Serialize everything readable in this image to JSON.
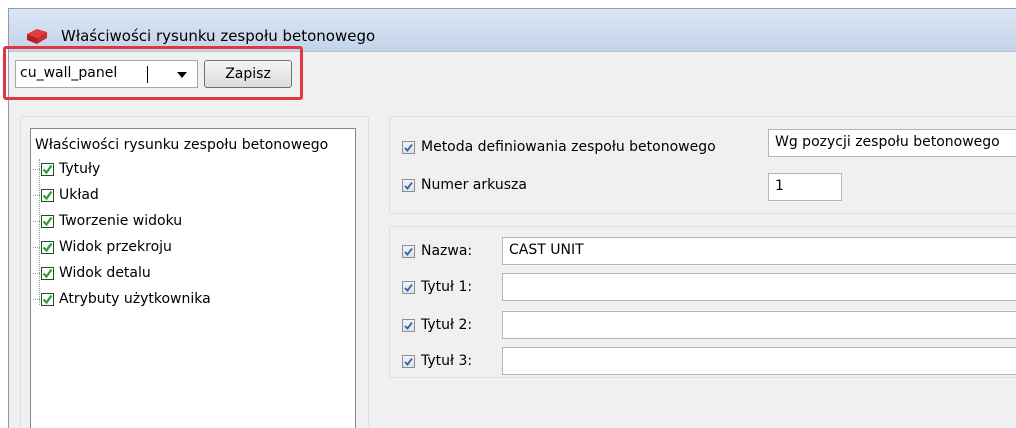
{
  "window": {
    "title": "Właściwości rysunku zespołu betonowego",
    "icon": "app-icon"
  },
  "toolbar": {
    "preset_value": "cu_wall_panel",
    "save_label": "Zapisz"
  },
  "tree": {
    "root_label": "Właściwości rysunku zespołu betonowego",
    "items": [
      {
        "label": "Tytuły",
        "checked": true
      },
      {
        "label": "Układ",
        "checked": true
      },
      {
        "label": "Tworzenie widoku",
        "checked": true
      },
      {
        "label": "Widok przekroju",
        "checked": true
      },
      {
        "label": "Widok detalu",
        "checked": true
      },
      {
        "label": "Atrybuty użytkownika",
        "checked": true
      }
    ]
  },
  "general": {
    "method_label": "Metoda definiowania zespołu betonowego",
    "method_value": "Wg pozycji zespołu betonowego",
    "sheet_label": "Numer arkusza",
    "sheet_value": "1"
  },
  "titles": {
    "name_label": "Nazwa:",
    "name_value": "CAST UNIT",
    "title1_label": "Tytuł 1:",
    "title1_value": "",
    "title2_label": "Tytuł 2:",
    "title2_value": "",
    "title3_label": "Tytuł 3:",
    "title3_value": ""
  },
  "colors": {
    "highlight": "#e2353f",
    "tree_check": "#2e9e2e",
    "blue_check": "#3a5f95"
  }
}
